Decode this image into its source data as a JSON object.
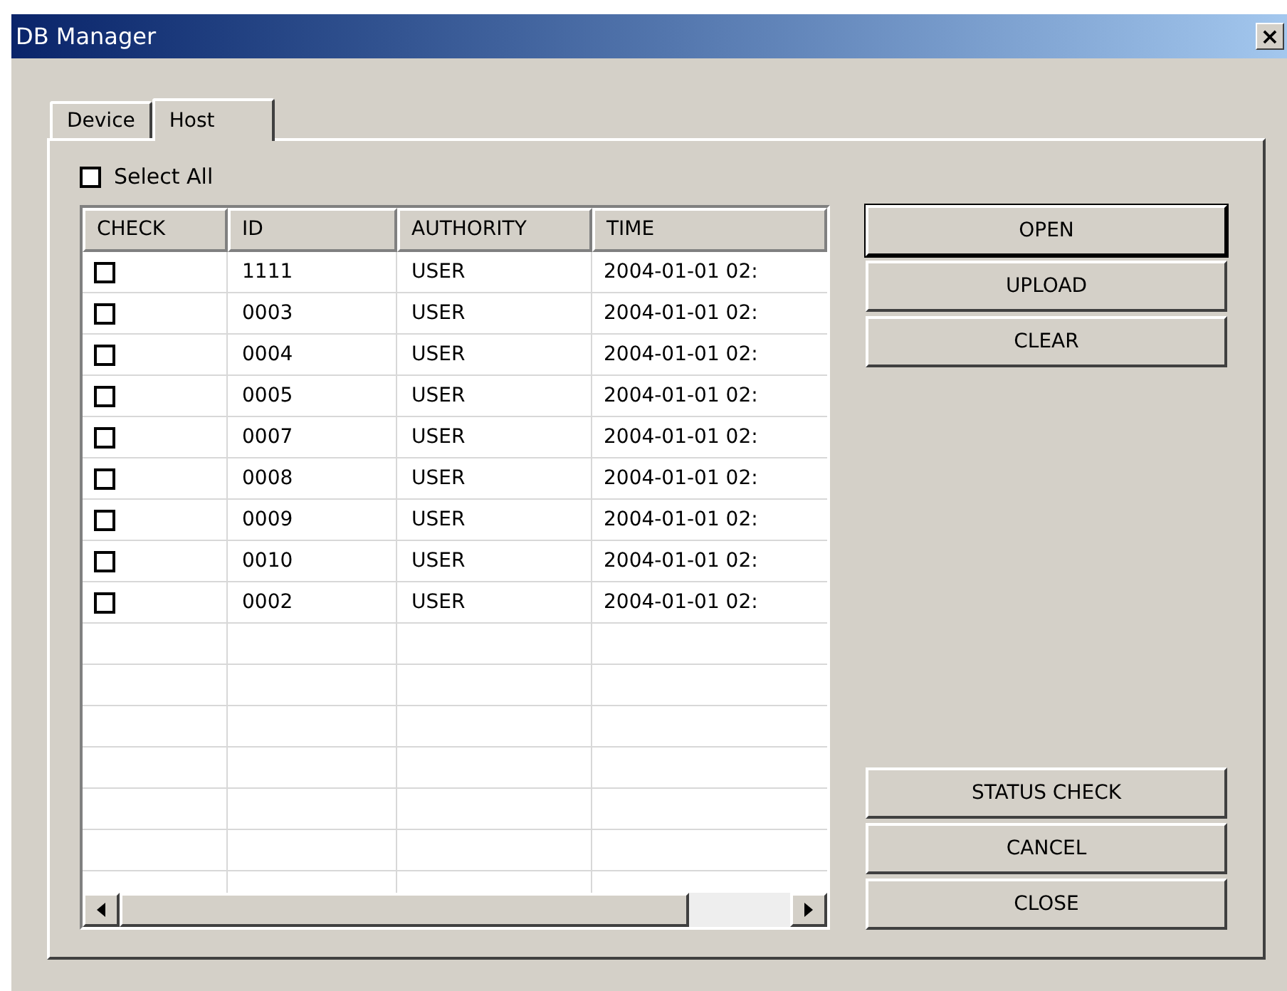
{
  "window": {
    "title": "DB Manager",
    "close": "×"
  },
  "tabs": [
    {
      "label": "Device",
      "selected": false
    },
    {
      "label": "Host",
      "selected": true
    }
  ],
  "select_all": {
    "label": "Select All",
    "checked": false
  },
  "table": {
    "columns": [
      "CHECK",
      "ID",
      "AUTHORITY",
      "TIME"
    ],
    "rows": [
      {
        "checked": false,
        "id": "1111",
        "authority": "USER",
        "time": "2004-01-01 02:"
      },
      {
        "checked": false,
        "id": "0003",
        "authority": "USER",
        "time": "2004-01-01 02:"
      },
      {
        "checked": false,
        "id": "0004",
        "authority": "USER",
        "time": "2004-01-01 02:"
      },
      {
        "checked": false,
        "id": "0005",
        "authority": "USER",
        "time": "2004-01-01 02:"
      },
      {
        "checked": false,
        "id": "0007",
        "authority": "USER",
        "time": "2004-01-01 02:"
      },
      {
        "checked": false,
        "id": "0008",
        "authority": "USER",
        "time": "2004-01-01 02:"
      },
      {
        "checked": false,
        "id": "0009",
        "authority": "USER",
        "time": "2004-01-01 02:"
      },
      {
        "checked": false,
        "id": "0010",
        "authority": "USER",
        "time": "2004-01-01 02:"
      },
      {
        "checked": false,
        "id": "0002",
        "authority": "USER",
        "time": "2004-01-01 02:"
      }
    ]
  },
  "buttons_top": [
    {
      "label": "OPEN",
      "default": true
    },
    {
      "label": "UPLOAD",
      "default": false
    },
    {
      "label": "CLEAR",
      "default": false
    }
  ],
  "buttons_bottom": [
    {
      "label": "STATUS CHECK",
      "default": false
    },
    {
      "label": "CANCEL",
      "default": false
    },
    {
      "label": "CLOSE",
      "default": false
    }
  ]
}
